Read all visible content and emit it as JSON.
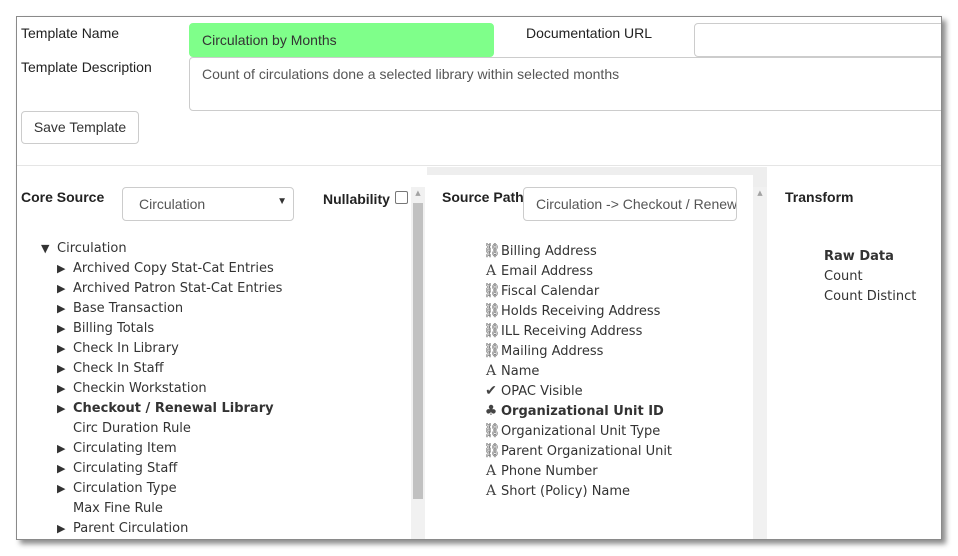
{
  "header": {
    "template_name_label": "Template Name",
    "template_name_value": "Circulation by Months",
    "documentation_url_label": "Documentation URL",
    "documentation_url_value": "",
    "template_description_label": "Template Description",
    "template_description_value": "Count of circulations done a selected library within selected months",
    "save_button": "Save Template"
  },
  "source": {
    "core_source_label": "Core Source",
    "core_source_value": "Circulation",
    "nullability_label": "Nullability",
    "source_path_label": "Source Path",
    "source_path_value": "Circulation -> Checkout / Renewal Library",
    "transform_label": "Transform"
  },
  "tree": {
    "root": "Circulation",
    "items": [
      {
        "label": "Archived Copy Stat-Cat Entries",
        "expandable": true,
        "bold": false
      },
      {
        "label": "Archived Patron Stat-Cat Entries",
        "expandable": true,
        "bold": false
      },
      {
        "label": "Base Transaction",
        "expandable": true,
        "bold": false
      },
      {
        "label": "Billing Totals",
        "expandable": true,
        "bold": false
      },
      {
        "label": "Check In Library",
        "expandable": true,
        "bold": false
      },
      {
        "label": "Check In Staff",
        "expandable": true,
        "bold": false
      },
      {
        "label": "Checkin Workstation",
        "expandable": true,
        "bold": false
      },
      {
        "label": "Checkout / Renewal Library",
        "expandable": true,
        "bold": true
      },
      {
        "label": "Circ Duration Rule",
        "expandable": false,
        "bold": false
      },
      {
        "label": "Circulating Item",
        "expandable": true,
        "bold": false
      },
      {
        "label": "Circulating Staff",
        "expandable": true,
        "bold": false
      },
      {
        "label": "Circulation Type",
        "expandable": true,
        "bold": false
      },
      {
        "label": "Max Fine Rule",
        "expandable": false,
        "bold": false
      },
      {
        "label": "Parent Circulation",
        "expandable": true,
        "bold": false
      }
    ]
  },
  "fields": [
    {
      "label": "Billing Address",
      "icon": "link-icon",
      "glyph": "⛓",
      "bold": false
    },
    {
      "label": "Email Address",
      "icon": "text-icon",
      "glyph": "A",
      "bold": false
    },
    {
      "label": "Fiscal Calendar",
      "icon": "link-icon",
      "glyph": "⛓",
      "bold": false
    },
    {
      "label": "Holds Receiving Address",
      "icon": "link-icon",
      "glyph": "⛓",
      "bold": false
    },
    {
      "label": "ILL Receiving Address",
      "icon": "link-icon",
      "glyph": "⛓",
      "bold": false
    },
    {
      "label": "Mailing Address",
      "icon": "link-icon",
      "glyph": "⛓",
      "bold": false
    },
    {
      "label": "Name",
      "icon": "text-icon",
      "glyph": "A",
      "bold": false
    },
    {
      "label": "OPAC Visible",
      "icon": "check-circle-icon",
      "glyph": "✔",
      "bold": false
    },
    {
      "label": "Organizational Unit ID",
      "icon": "tree-icon",
      "glyph": "♣",
      "bold": true
    },
    {
      "label": "Organizational Unit Type",
      "icon": "link-icon",
      "glyph": "⛓",
      "bold": false
    },
    {
      "label": "Parent Organizational Unit",
      "icon": "link-icon",
      "glyph": "⛓",
      "bold": false
    },
    {
      "label": "Phone Number",
      "icon": "text-icon",
      "glyph": "A",
      "bold": false
    },
    {
      "label": "Short (Policy) Name",
      "icon": "text-icon",
      "glyph": "A",
      "bold": false
    }
  ],
  "transform": {
    "items": [
      {
        "label": "Raw Data",
        "bold": true
      },
      {
        "label": "Count",
        "bold": false
      },
      {
        "label": "Count Distinct",
        "bold": false
      }
    ]
  },
  "colors": {
    "name_input_bg": "#7fff8a",
    "panel_gray": "#eeeeee"
  }
}
